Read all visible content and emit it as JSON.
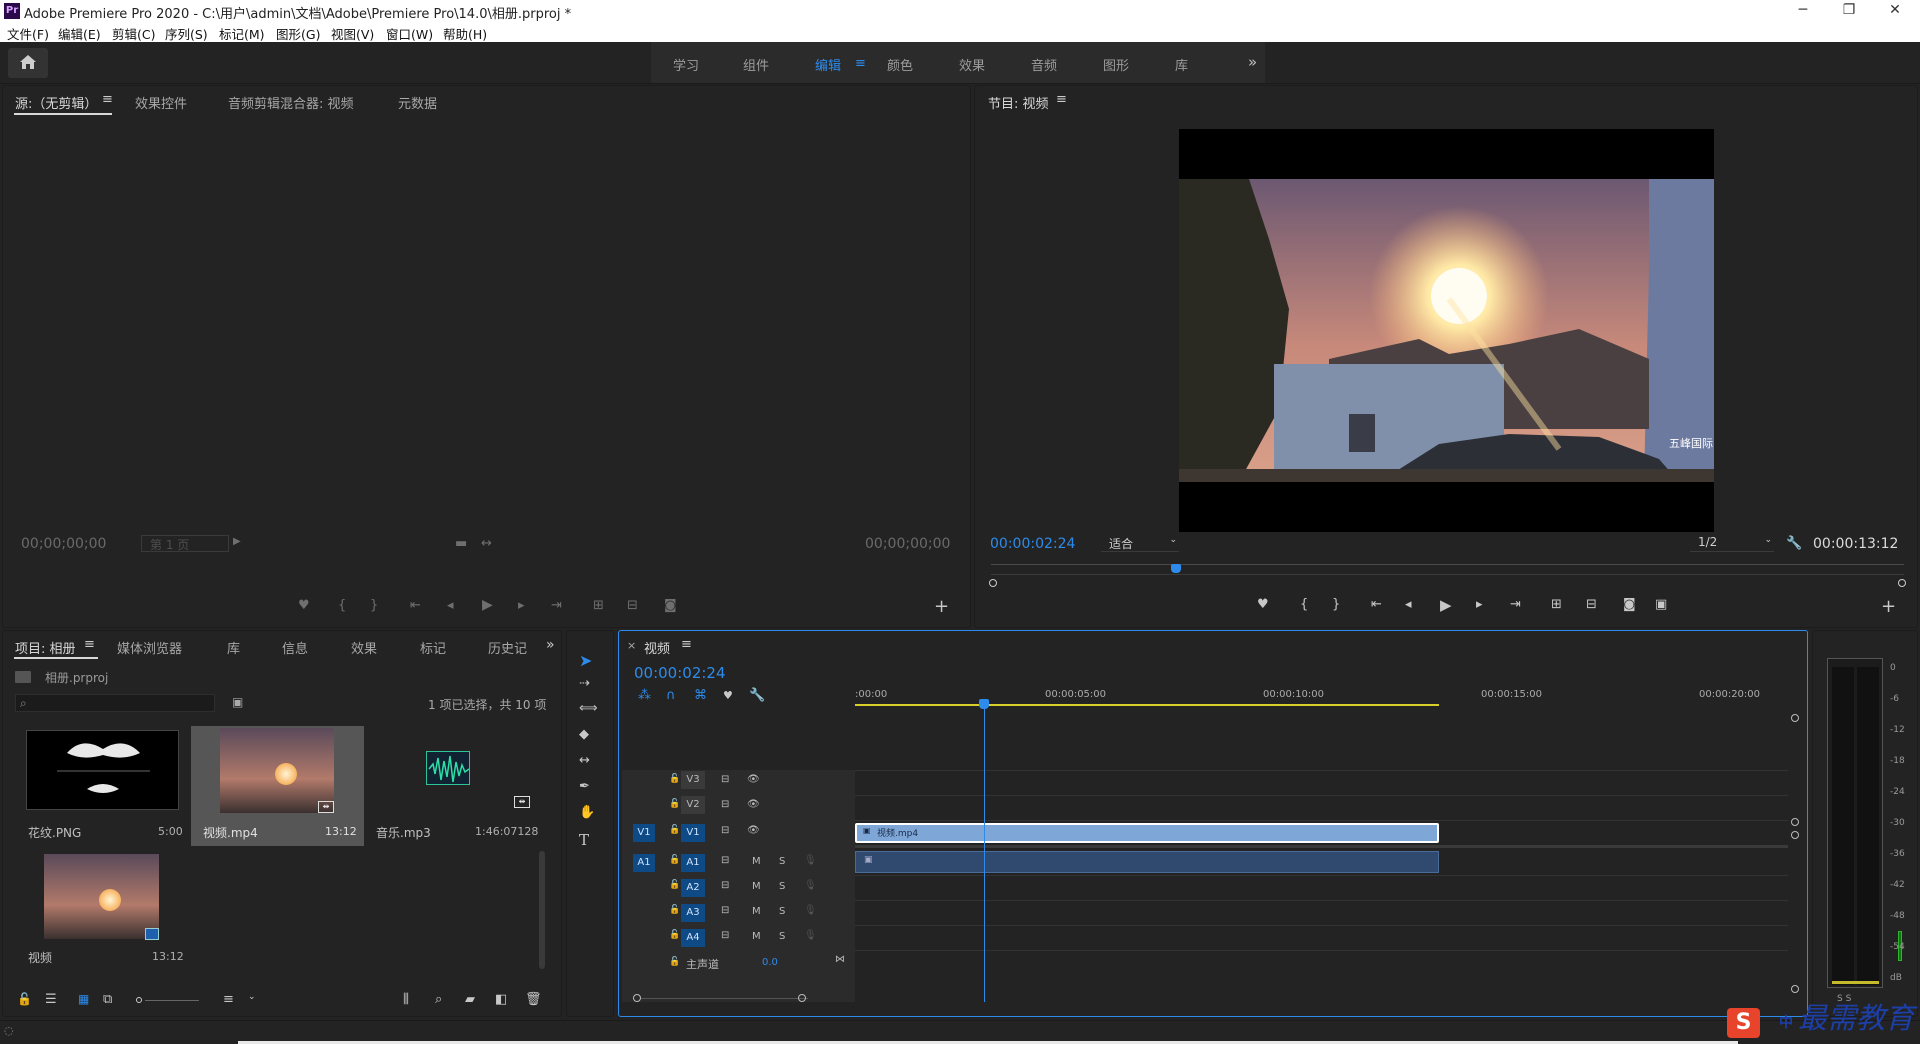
{
  "window": {
    "app_icon": "Pr",
    "title": "Adobe Premiere Pro 2020 - C:\\用户\\admin\\文档\\Adobe\\Premiere Pro\\14.0\\相册.prproj *",
    "minimize": "─",
    "maximize": "❐",
    "close": "✕"
  },
  "menu": [
    "文件(F)",
    "编辑(E)",
    "剪辑(C)",
    "序列(S)",
    "标记(M)",
    "图形(G)",
    "视图(V)",
    "窗口(W)",
    "帮助(H)"
  ],
  "workspaces": {
    "tabs": [
      "学习",
      "组件",
      "编辑",
      "颜色",
      "效果",
      "音频",
      "图形",
      "库"
    ],
    "active_index": 2,
    "more": "»"
  },
  "source_panel": {
    "tabs": [
      "源:（无剪辑）",
      "效果控件",
      "音频剪辑混合器: 视频",
      "元数据"
    ],
    "tc_left": "00;00;00;00",
    "page_select": "第 1 页",
    "tc_right": "00;00;00;00"
  },
  "program_panel": {
    "title": "节目: 视频",
    "timecode": "00:00:02:24",
    "fit": "适合",
    "resolution": "1/2",
    "duration": "00:00:13:12",
    "playhead_fraction": 0.203,
    "sign_text": "五峰国际"
  },
  "project_panel": {
    "tabs": [
      "项目: 相册",
      "媒体浏览器",
      "库",
      "信息",
      "效果",
      "标记",
      "历史记"
    ],
    "more": "»",
    "project_file": "相册.prproj",
    "selection_info": "1 项已选择，共 10 项",
    "items": [
      {
        "name": "花纹.PNG",
        "duration": "5:00"
      },
      {
        "name": "视频.mp4",
        "duration": "13:12"
      },
      {
        "name": "音乐.mp3",
        "duration": "1:46:07128"
      },
      {
        "name": "视频",
        "duration": "13:12"
      }
    ]
  },
  "timeline": {
    "tab": "视频",
    "close": "×",
    "timecode": "00:00:02:24",
    "ruler": [
      ":00:00",
      "00:00:05:00",
      "00:00:10:00",
      "00:00:15:00",
      "00:00:20:00"
    ],
    "video_tracks": [
      "V3",
      "V2",
      "V1"
    ],
    "audio_tracks": [
      "A1",
      "A2",
      "A3",
      "A4"
    ],
    "source_v": "V1",
    "source_a": "A1",
    "master_label": "主声道",
    "master_value": "0.0",
    "mute": "M",
    "solo": "S",
    "clip_name": "视频.mp4",
    "playhead_seconds": 2.96,
    "clip_end_seconds": 13.4
  },
  "meter": {
    "scale": [
      "0",
      "-6",
      "-12",
      "-18",
      "-24",
      "-30",
      "-36",
      "-42",
      "-48",
      "-54",
      "dB"
    ],
    "bottom": "S  S"
  },
  "watermark": {
    "brand": "最需教育",
    "ime_icon": "S",
    "ime_mode": "中"
  },
  "colors": {
    "accent": "#2d8ceb",
    "clip": "#7ea7d8",
    "workarea": "#d9cf2a"
  }
}
